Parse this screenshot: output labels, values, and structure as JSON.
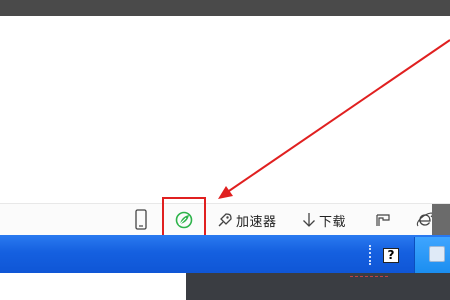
{
  "status_bar": {
    "items": [
      {
        "icon": "phone-icon",
        "label": ""
      },
      {
        "icon": "leaf-acceleration-icon",
        "label": ""
      },
      {
        "icon": "rocket-icon",
        "label": "加速器"
      },
      {
        "icon": "download-arrow-icon",
        "label": "下载"
      },
      {
        "icon": "flag-icon",
        "label": ""
      },
      {
        "icon": "ie-browser-icon",
        "label": ""
      }
    ]
  },
  "taskbar": {
    "help_icon_text": "?"
  },
  "colors": {
    "annotation_red": "#e02020",
    "taskbar_blue": "#1560e0",
    "leaf_green": "#2db34a"
  }
}
